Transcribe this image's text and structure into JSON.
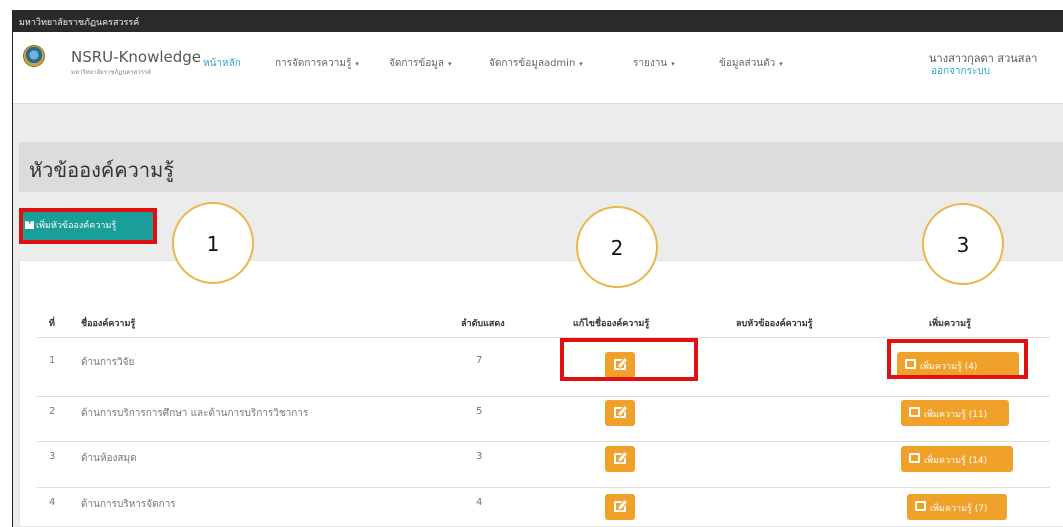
{
  "topbar": {
    "org": "มหาวิทยาลัยราชภัฏนครสวรรค์"
  },
  "brand": {
    "name_prefix": "NSRU-",
    "name_suffix": "Knowledge",
    "subtitle": "มหาวิทยาลัยราชภัฏนครสวรรค์"
  },
  "nav": {
    "home": "หน้าหลัก",
    "items": [
      "การจัดการความรู้",
      "จัดการข้อมูล",
      "จัดการข้อมูลadmin",
      "รายงาน",
      "ข้อมูลส่วนตัว"
    ],
    "caret": "▾"
  },
  "user": {
    "name": "นางสาวกุลดา สวนสลา",
    "logout": "ออกจากระบบ"
  },
  "page": {
    "title": "หัวข้อองค์ความรู้",
    "add_topic_label": "เพิ่มหัวข้อองค์ความรู้"
  },
  "annotations": [
    "1",
    "2",
    "3"
  ],
  "table": {
    "headers": [
      "ที่",
      "ชื่อองค์ความรู้",
      "ลำดับแสดง",
      "แก้ไขชื่อองค์ความรู้",
      "ลบหัวข้อองค์ความรู้",
      "เพิ่มความรู้"
    ],
    "rows": [
      {
        "no": "1",
        "name": "ด้านการวิจัย",
        "order": "7",
        "add_label": "เพิ่มความรู้ (4)"
      },
      {
        "no": "2",
        "name": "ด้านการบริการการศึกษา และด้านการบริการวิชาการ",
        "order": "5",
        "add_label": "เพิ่มความรู้ (11)"
      },
      {
        "no": "3",
        "name": "ด้านห้องสมุด",
        "order": "3",
        "add_label": "เพิ่มความรู้ (14)"
      },
      {
        "no": "4",
        "name": "ด้านการบริหารจัดการ",
        "order": "4",
        "add_label": "เพิ่มความรู้ (7)"
      }
    ]
  },
  "colors": {
    "accent": "#2fa7c9",
    "teal_button": "#1a9e9a",
    "orange_button": "#f0a12a",
    "highlight_red": "#e01010",
    "circle_border": "#e8b84a"
  }
}
